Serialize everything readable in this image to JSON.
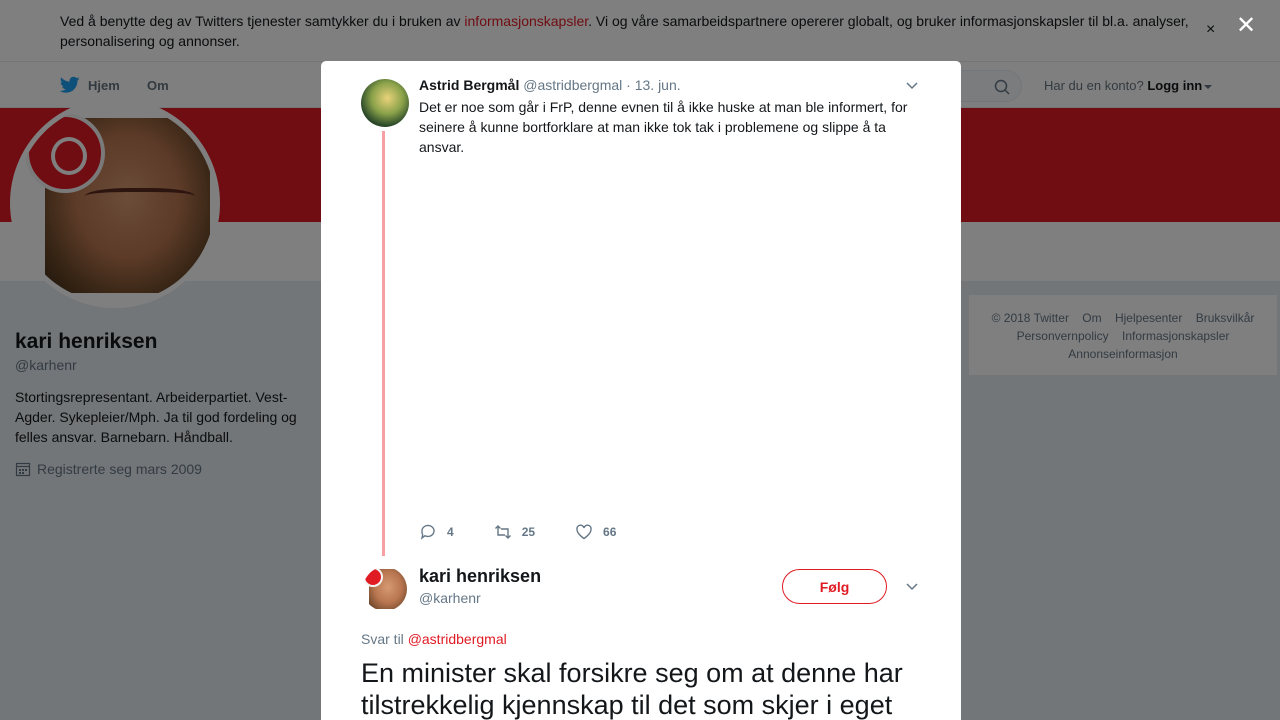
{
  "cookie_banner": {
    "text_before": "Ved å benytte deg av Twitters tjenester samtykker du i bruken av ",
    "link": "informasjonskapsler",
    "text_after": ". Vi og våre samarbeidspartnere opererer globalt, og bruker informasjonskapsler til bl.a. analyser, personalisering og annonser.",
    "close": "×"
  },
  "nav": {
    "home": "Hjem",
    "about": "Om",
    "account_prompt": "Har du en konto?",
    "login": "Logg inn"
  },
  "profile": {
    "name": "kari henriksen",
    "handle": "@karhenr",
    "bio": "Stortingsrepresentant. Arbeiderpartiet. Vest-Agder. Sykepleier/Mph. Ja til god fordeling og felles ansvar. Barnebarn. Håndball.",
    "joined": "Registrerte seg mars 2009"
  },
  "footer": {
    "links": [
      "© 2018 Twitter",
      "Om",
      "Hjelpesenter",
      "Bruksvilkår",
      "Personvernpolicy",
      "Informasjonskapsler",
      "Annonseinformasjon"
    ]
  },
  "modal": {
    "close": "✕",
    "parent_tweet": {
      "name": "Astrid Bergmål",
      "handle": "@astridbergmal",
      "date": "· 13. jun.",
      "text": "Det er noe som går i FrP, denne evnen til å ikke huske at man ble informert, for seinere å kunne bortforklare at man ikke tok tak i problemene og slippe å ta ansvar.",
      "replies": "4",
      "retweets": "25",
      "likes": "66"
    },
    "main_tweet": {
      "name": "kari henriksen",
      "handle": "@karhenr",
      "follow": "Følg",
      "reply_prefix": "Svar til ",
      "reply_to": "@astridbergmal",
      "text": "En minister skal forsikre seg om at denne har tilstrekkelig kjennskap til det som skjer i eget"
    }
  },
  "colors": {
    "brand_red": "#e01b24",
    "twitter_blue": "#1da1f2",
    "muted": "#657786"
  }
}
